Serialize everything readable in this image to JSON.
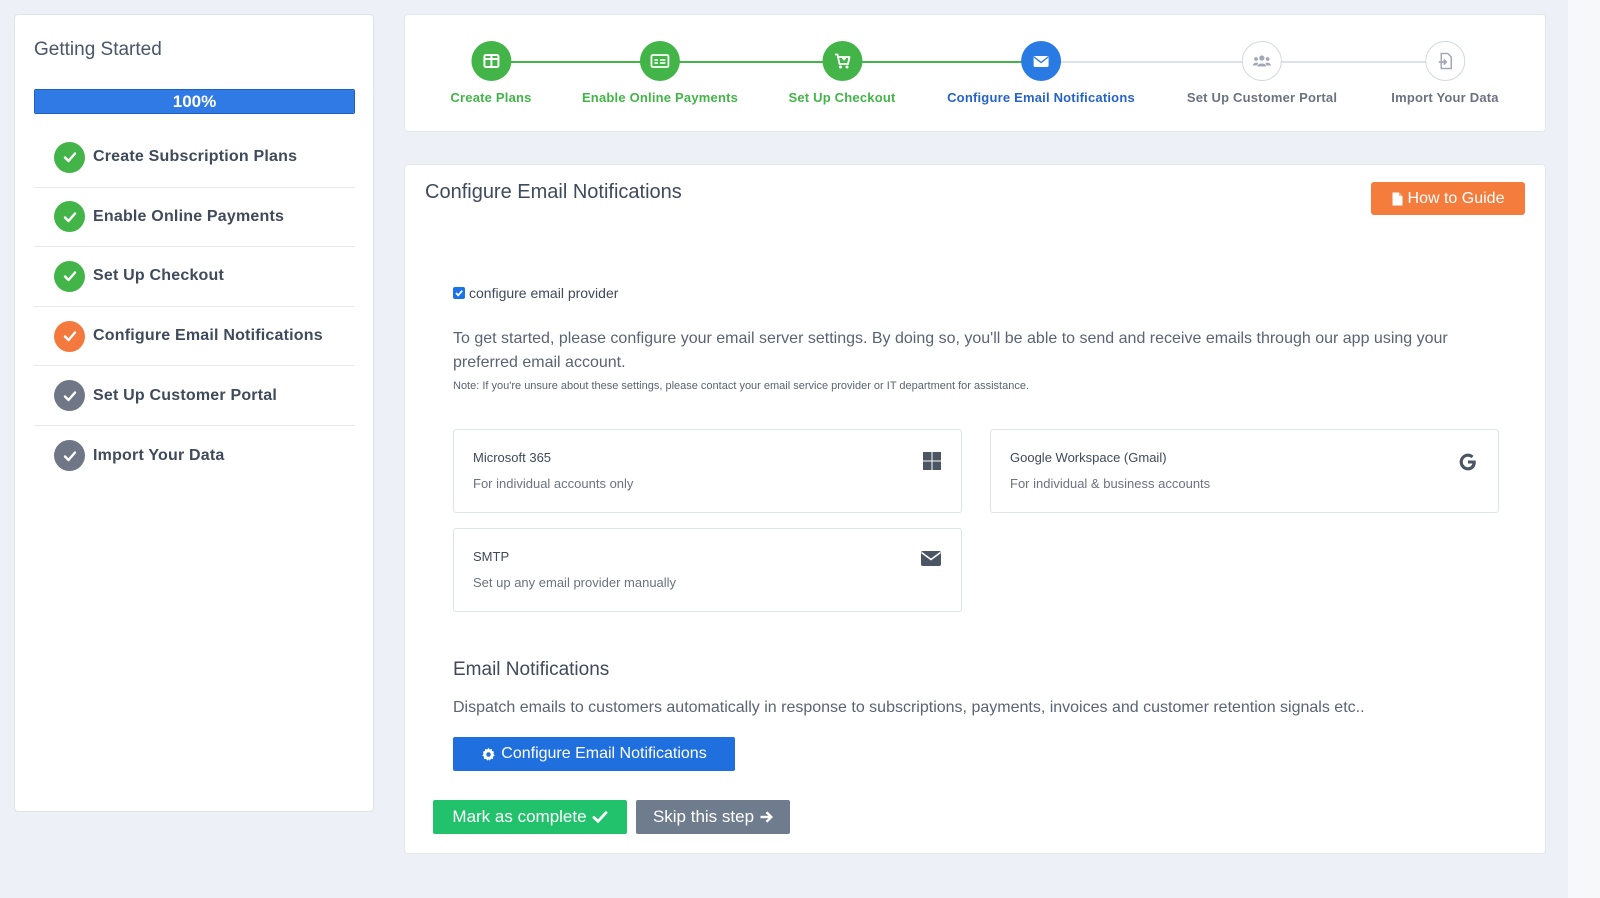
{
  "colors": {
    "complete": "#43b548",
    "current_sidebar": "#f4793e",
    "pending": "#6f7786",
    "active_step": "#2a7ae4",
    "inactive_step": "#b3bac6"
  },
  "sidebar": {
    "title": "Getting Started",
    "progress_value": 1.0,
    "progress_label": "100%",
    "items": [
      {
        "label": "Create Subscription Plans",
        "status": "complete"
      },
      {
        "label": "Enable Online Payments",
        "status": "complete"
      },
      {
        "label": "Set Up Checkout",
        "status": "complete"
      },
      {
        "label": "Configure Email Notifications",
        "status": "current"
      },
      {
        "label": "Set Up Customer Portal",
        "status": "pending"
      },
      {
        "label": "Import Your Data",
        "status": "pending"
      }
    ]
  },
  "stepper": {
    "steps": [
      {
        "label": "Create Plans",
        "icon": "plans-icon",
        "status": "complete"
      },
      {
        "label": "Enable Online Payments",
        "icon": "payment-card-icon",
        "status": "complete"
      },
      {
        "label": "Set Up Checkout",
        "icon": "cart-icon",
        "status": "complete"
      },
      {
        "label": "Configure Email Notifications",
        "icon": "envelope-icon",
        "status": "active"
      },
      {
        "label": "Set Up Customer Portal",
        "icon": "users-icon",
        "status": "inactive"
      },
      {
        "label": "Import Your Data",
        "icon": "file-import-icon",
        "status": "inactive"
      }
    ]
  },
  "main": {
    "title": "Configure Email Notifications",
    "guide_button": "How to Guide",
    "checkbox_label": "configure email provider",
    "checkbox_checked": true,
    "intro": "To get started, please configure your email server settings. By doing so, you'll be able to send and receive emails through our app using your preferred email account.",
    "note": "Note: If you're unsure about these settings, please contact your email service provider or IT department for assistance.",
    "providers": [
      {
        "name": "Microsoft 365",
        "description": "For individual accounts only",
        "icon": "windows-icon"
      },
      {
        "name": "Google Workspace (Gmail)",
        "description": "For individual & business accounts",
        "icon": "google-icon"
      },
      {
        "name": "SMTP",
        "description": "Set up any email provider manually",
        "icon": "envelope-icon"
      }
    ],
    "notifications_title": "Email Notifications",
    "notifications_desc": "Dispatch emails to customers automatically in response to subscriptions, payments, invoices and customer retention signals etc..",
    "configure_button": "Configure Email Notifications",
    "complete_button": "Mark as complete",
    "skip_button": "Skip this step"
  }
}
